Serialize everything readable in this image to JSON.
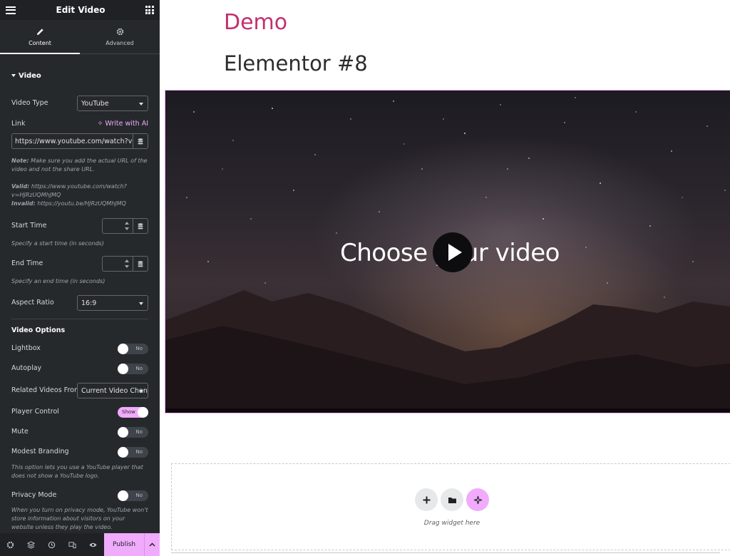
{
  "header": {
    "title": "Edit Video"
  },
  "tabs": [
    {
      "label": "Content",
      "active": true
    },
    {
      "label": "Advanced",
      "active": false
    }
  ],
  "video_section": {
    "title": "Video",
    "video_type_label": "Video Type",
    "video_type_value": "YouTube",
    "link_label": "Link",
    "write_ai_label": "Write with AI",
    "link_value": "https://www.youtube.com/watch?v",
    "note_prefix": "Note:",
    "note_text": " Make sure you add the actual URL of the video and not the share URL.",
    "valid_prefix": "Valid:",
    "valid_text": " https://www.youtube.com/watch?v=HJRzUQMhJMQ",
    "invalid_prefix": "Invalid:",
    "invalid_text": " https://youtu.be/HJRzUQMhJMQ",
    "start_time_label": "Start Time",
    "start_time_help": "Specify a start time (in seconds)",
    "end_time_label": "End Time",
    "end_time_help": "Specify an end time (in seconds)",
    "aspect_ratio_label": "Aspect Ratio",
    "aspect_ratio_value": "16:9"
  },
  "video_options": {
    "title": "Video Options",
    "lightbox": {
      "label": "Lightbox",
      "state": "No"
    },
    "autoplay": {
      "label": "Autoplay",
      "state": "No"
    },
    "related_label": "Related Videos From",
    "related_value": "Current Video Channel",
    "player_control": {
      "label": "Player Control",
      "state": "Show"
    },
    "mute": {
      "label": "Mute",
      "state": "No"
    },
    "modest_branding": {
      "label": "Modest Branding",
      "state": "No"
    },
    "modest_help": "This option lets you use a YouTube player that does not show a YouTube logo.",
    "privacy_mode": {
      "label": "Privacy Mode",
      "state": "No"
    },
    "privacy_help": "When you turn on privacy mode, YouTube won't store information about visitors on your website unless they play the video."
  },
  "footer": {
    "publish_label": "Publish"
  },
  "canvas": {
    "site_title": "Demo",
    "page_title": "Elementor #8",
    "video_overlay_text": "Choose your video",
    "dropzone_text": "Drag widget here"
  },
  "colors": {
    "accent": "#f0abfc",
    "site_title": "#c3306d",
    "sidebar_bg": "#26292c"
  }
}
